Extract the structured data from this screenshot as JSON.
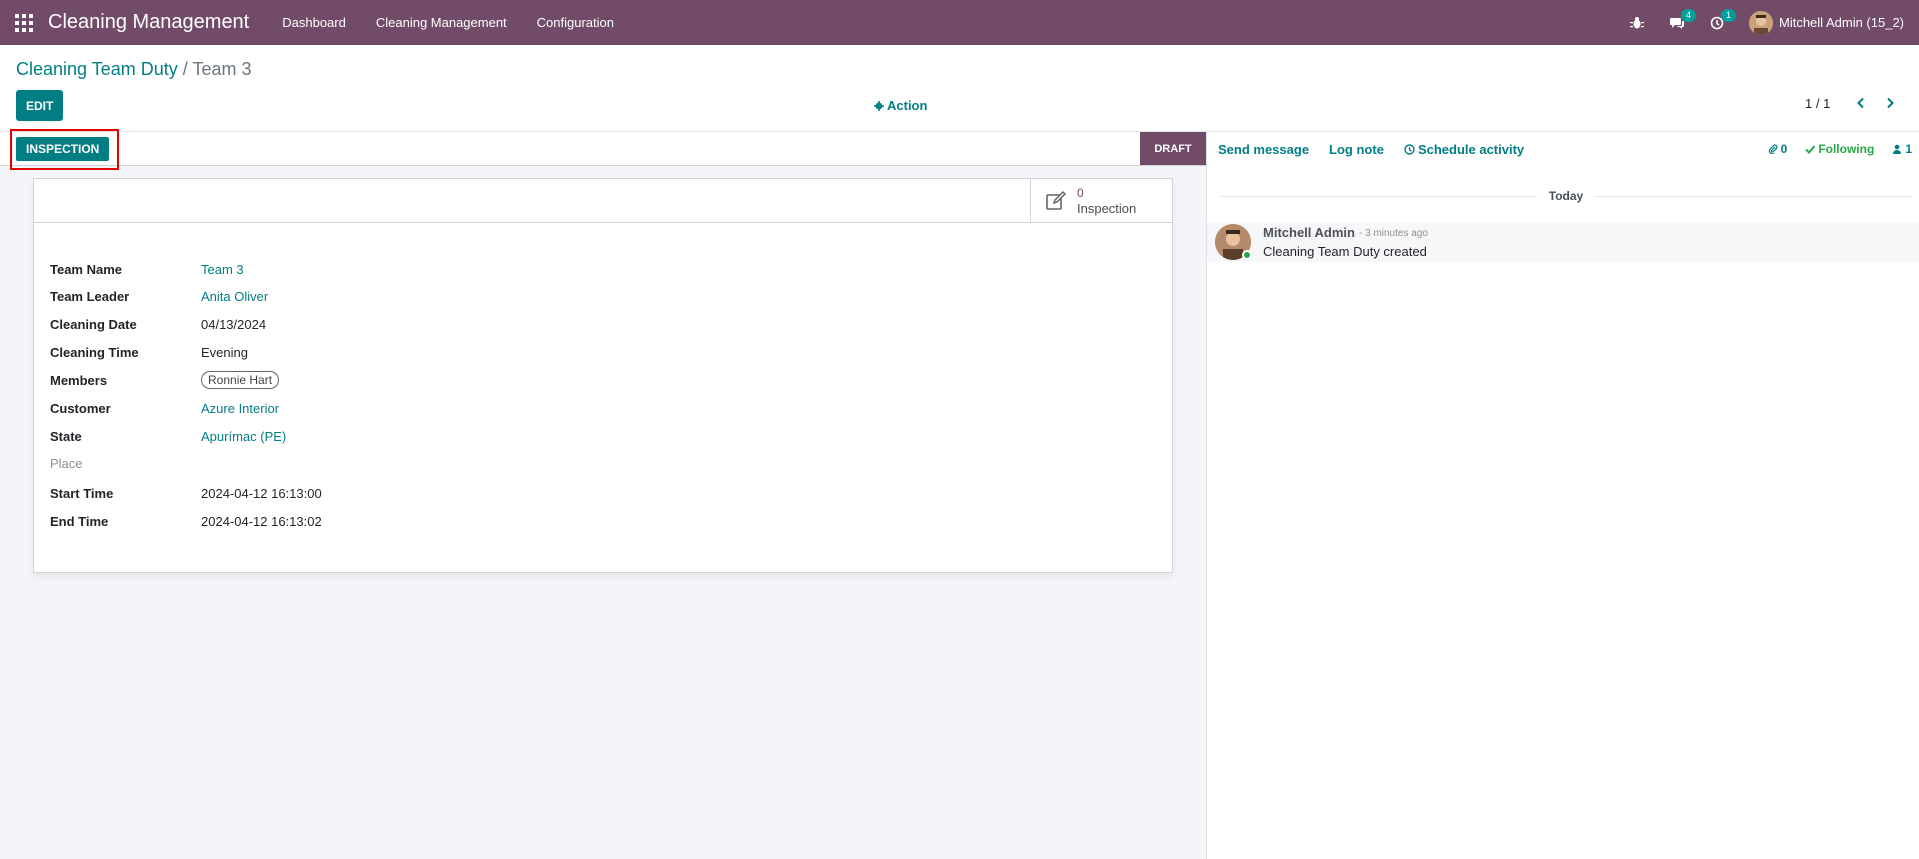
{
  "navbar": {
    "app_title": "Cleaning Management",
    "menu": [
      "Dashboard",
      "Cleaning Management",
      "Configuration"
    ],
    "messages_count": "4",
    "activities_count": "1",
    "user_name": "Mitchell Admin (15_2)"
  },
  "control_panel": {
    "breadcrumb_parent": "Cleaning Team Duty",
    "breadcrumb_separator": "/",
    "breadcrumb_current": "Team 3",
    "edit_label": "EDIT",
    "action_label": "Action",
    "pager": "1 / 1"
  },
  "statusbar": {
    "inspection_label": "INSPECTION",
    "stage": "DRAFT"
  },
  "smart_button": {
    "count": "0",
    "label": "Inspection"
  },
  "fields": {
    "team_name": {
      "label": "Team Name",
      "value": "Team 3"
    },
    "team_leader": {
      "label": "Team Leader",
      "value": "Anita Oliver"
    },
    "cleaning_date": {
      "label": "Cleaning Date",
      "value": "04/13/2024"
    },
    "cleaning_time": {
      "label": "Cleaning Time",
      "value": "Evening"
    },
    "members": {
      "label": "Members",
      "value": "Ronnie Hart"
    },
    "customer": {
      "label": "Customer",
      "value": "Azure Interior"
    },
    "state": {
      "label": "State",
      "value": "Apurímac (PE)"
    },
    "place": {
      "label": "Place",
      "value": ""
    },
    "start_time": {
      "label": "Start Time",
      "value": "2024-04-12 16:13:00"
    },
    "end_time": {
      "label": "End Time",
      "value": "2024-04-12 16:13:02"
    }
  },
  "chatter": {
    "send_message": "Send message",
    "log_note": "Log note",
    "schedule_activity": "Schedule activity",
    "attachments_count": "0",
    "following": "Following",
    "followers_count": "1",
    "date_separator": "Today",
    "message": {
      "author": "Mitchell Admin",
      "date": "- 3 minutes ago",
      "body": "Cleaning Team Duty created"
    }
  },
  "colors": {
    "brand": "#714b67",
    "accent": "#017e84",
    "highlight": "#e30000",
    "following": "#28a745"
  }
}
